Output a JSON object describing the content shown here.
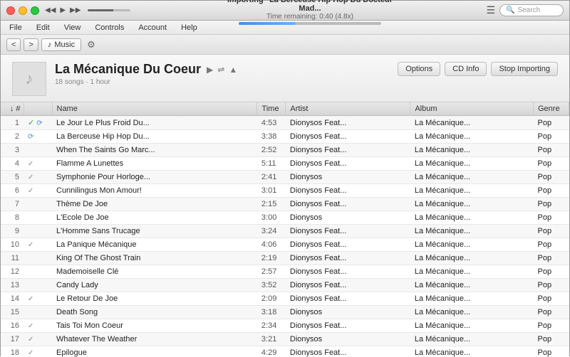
{
  "window": {
    "title": "Importing \"La Berceuse Hip Hop Du Docteur Mad...",
    "subtitle": "Time remaining: 0:40 (4.8x)",
    "progress": 40
  },
  "transport": {
    "rewind": "◀◀",
    "play": "▶",
    "forward": "▶▶"
  },
  "search": {
    "placeholder": "Search"
  },
  "menu": {
    "items": [
      "File",
      "Edit",
      "View",
      "Controls",
      "Account",
      "Help"
    ]
  },
  "toolbar": {
    "back": "<",
    "forward": ">",
    "breadcrumb_icon": "♪",
    "breadcrumb": "Music",
    "gear": "⚙"
  },
  "album": {
    "icon": "♪",
    "title": "La Mécanique Du Coeur",
    "meta": "18 songs · 1 hour",
    "btn_options": "Options",
    "btn_cdinfo": "CD Info",
    "btn_stop": "Stop Importing"
  },
  "table": {
    "headers": [
      "#",
      "",
      "Name",
      "Time",
      "Artist",
      "Album",
      "Genre"
    ],
    "sort_col": "Name",
    "tracks": [
      {
        "num": "1",
        "status": "importing",
        "name": "Le Jour Le Plus Froid Du...",
        "time": "4:53",
        "artist": "Dionysos Feat...",
        "album": "La Mécanique...",
        "genre": "Pop"
      },
      {
        "num": "2",
        "status": "importing2",
        "name": "La Berceuse Hip Hop Du...",
        "time": "3:38",
        "artist": "Dionysos Feat...",
        "album": "La Mécanique...",
        "genre": "Pop"
      },
      {
        "num": "3",
        "status": "none",
        "name": "When The Saints Go Marc...",
        "time": "2:52",
        "artist": "Dionysos Feat...",
        "album": "La Mécanique...",
        "genre": "Pop"
      },
      {
        "num": "4",
        "status": "check",
        "name": "Flamme A Lunettes",
        "time": "5:11",
        "artist": "Dionysos Feat...",
        "album": "La Mécanique...",
        "genre": "Pop"
      },
      {
        "num": "5",
        "status": "check",
        "name": "Symphonie Pour Horloge...",
        "time": "2:41",
        "artist": "Dionysos",
        "album": "La Mécanique...",
        "genre": "Pop"
      },
      {
        "num": "6",
        "status": "check",
        "name": "Cunnilingus Mon Amour!",
        "time": "3:01",
        "artist": "Dionysos Feat...",
        "album": "La Mécanique...",
        "genre": "Pop"
      },
      {
        "num": "7",
        "status": "none",
        "name": "Thème De Joe",
        "time": "2:15",
        "artist": "Dionysos Feat...",
        "album": "La Mécanique...",
        "genre": "Pop"
      },
      {
        "num": "8",
        "status": "none",
        "name": "L'Ecole De Joe",
        "time": "3:00",
        "artist": "Dionysos",
        "album": "La Mécanique...",
        "genre": "Pop"
      },
      {
        "num": "9",
        "status": "none",
        "name": "L'Homme Sans Trucage",
        "time": "3:24",
        "artist": "Dionysos Feat...",
        "album": "La Mécanique...",
        "genre": "Pop"
      },
      {
        "num": "10",
        "status": "check",
        "name": "La Panique Mécanique",
        "time": "4:06",
        "artist": "Dionysos Feat...",
        "album": "La Mécanique...",
        "genre": "Pop"
      },
      {
        "num": "11",
        "status": "none",
        "name": "King Of The Ghost Train",
        "time": "2:19",
        "artist": "Dionysos Feat...",
        "album": "La Mécanique...",
        "genre": "Pop"
      },
      {
        "num": "12",
        "status": "none",
        "name": "Mademoiselle Clé",
        "time": "2:57",
        "artist": "Dionysos Feat...",
        "album": "La Mécanique...",
        "genre": "Pop"
      },
      {
        "num": "13",
        "status": "none",
        "name": "Candy Lady",
        "time": "3:52",
        "artist": "Dionysos Feat...",
        "album": "La Mécanique...",
        "genre": "Pop"
      },
      {
        "num": "14",
        "status": "check",
        "name": "Le Retour De Joe",
        "time": "2:09",
        "artist": "Dionysos Feat...",
        "album": "La Mécanique...",
        "genre": "Pop"
      },
      {
        "num": "15",
        "status": "none",
        "name": "Death Song",
        "time": "3:18",
        "artist": "Dionysos",
        "album": "La Mécanique...",
        "genre": "Pop"
      },
      {
        "num": "16",
        "status": "check",
        "name": "Tais Toi Mon Coeur",
        "time": "2:34",
        "artist": "Dionysos Feat...",
        "album": "La Mécanique...",
        "genre": "Pop"
      },
      {
        "num": "17",
        "status": "check",
        "name": "Whatever The Weather",
        "time": "3:21",
        "artist": "Dionysos",
        "album": "La Mécanique...",
        "genre": "Pop"
      },
      {
        "num": "18",
        "status": "check",
        "name": "Epilogue",
        "time": "4:29",
        "artist": "Dionysos Feat...",
        "album": "La Mécanique...",
        "genre": "Pop"
      }
    ]
  }
}
